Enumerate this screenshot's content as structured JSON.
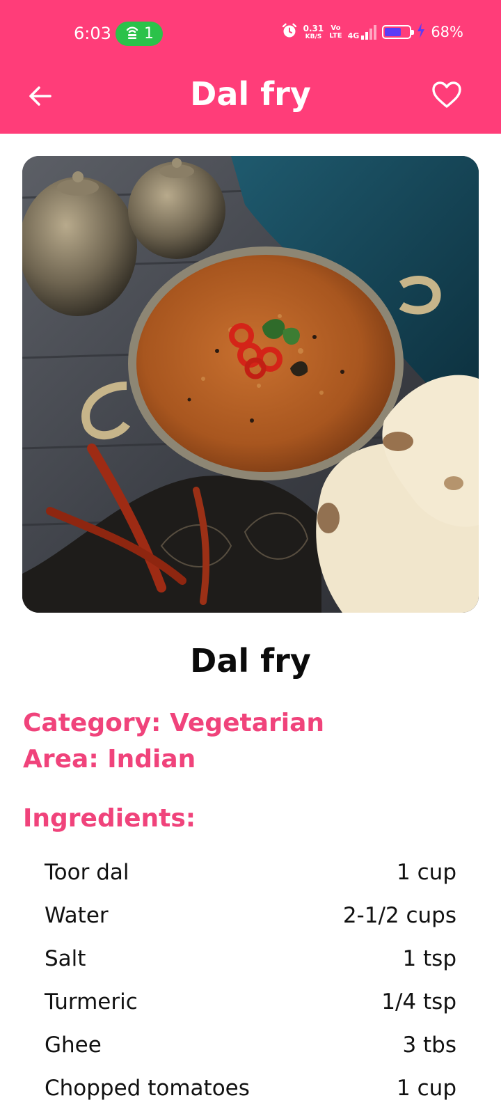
{
  "status_bar": {
    "time": "6:03",
    "hotspot_count": "1",
    "net_speed_value": "0.31",
    "net_speed_unit": "KB/S",
    "volte_top": "Vo",
    "volte_bottom": "LTE",
    "network_type": "4G",
    "battery_percent": "68%",
    "battery_level": 0.68
  },
  "app_bar": {
    "title": "Dal fry",
    "back_icon": "arrow-left-icon",
    "favorite_icon": "heart-outline-icon"
  },
  "recipe": {
    "title": "Dal fry",
    "category": "Category: Vegetarian",
    "area": "Area: Indian",
    "ingredients_heading": "Ingredients:",
    "ingredients": [
      {
        "name": "Toor dal",
        "measure": "1 cup"
      },
      {
        "name": "Water",
        "measure": "2-1/2 cups"
      },
      {
        "name": "Salt",
        "measure": "1 tsp"
      },
      {
        "name": "Turmeric",
        "measure": "1/4 tsp"
      },
      {
        "name": "Ghee",
        "measure": "3 tbs"
      },
      {
        "name": "Chopped tomatoes",
        "measure": "1 cup"
      }
    ]
  },
  "colors": {
    "primary": "#FF3D79",
    "accent_text": "#F0437B",
    "hotspot": "#2BC24A"
  }
}
